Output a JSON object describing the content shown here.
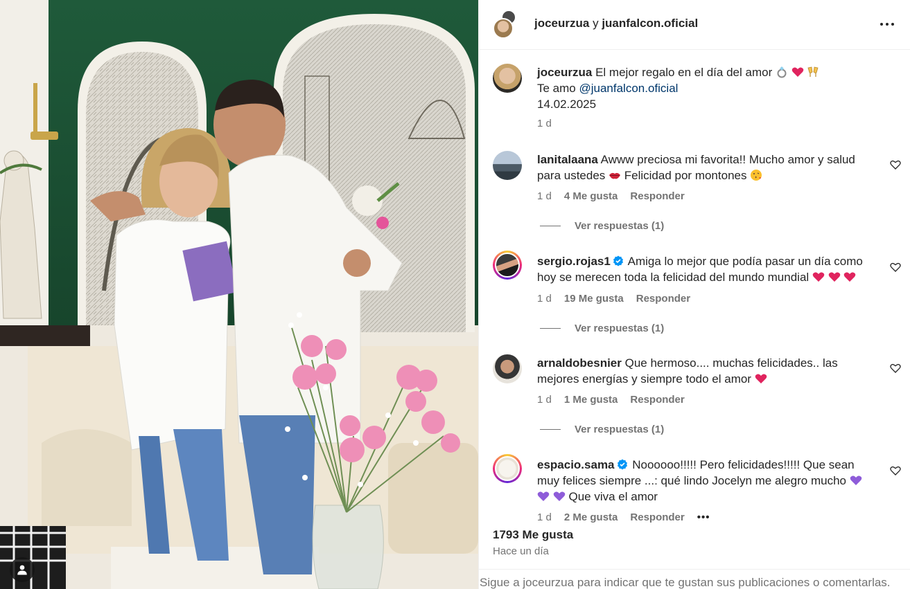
{
  "post": {
    "header_user1": "joceurzua",
    "header_conn": " y ",
    "header_user2": "juanfalcon.oficial",
    "caption_user": "joceurzua",
    "caption_line1": "El mejor regalo en el día del amor",
    "caption_line2_prefix": "Te amo ",
    "caption_mention": "@juanfalcon.oficial",
    "caption_line3": "14.02.2025",
    "caption_time": "1 d",
    "likes": "1793 Me gusta",
    "time_ago": "Hace un día",
    "footer_text": "Sigue a joceurzua para indicar que te gustan sus publicaciones o comentarlas."
  },
  "comments": [
    {
      "user": "lanitalaana",
      "text": "Awww preciosa mi favorita!! Mucho amor y salud para ustedes",
      "text2": "Felicidad por montones",
      "time": "1 d",
      "likes": "4 Me gusta",
      "reply": "Responder",
      "view_replies": "Ver respuestas (1)"
    },
    {
      "user": "sergio.rojas1",
      "text": "Amiga lo mejor que podía pasar un día como hoy se merecen toda la felicidad del mundo mundial",
      "time": "1 d",
      "likes": "19 Me gusta",
      "reply": "Responder",
      "view_replies": "Ver respuestas (1)"
    },
    {
      "user": "arnaldobesnier",
      "text": "Que hermoso.... muchas felicidades.. las mejores energías y siempre todo el amor",
      "time": "1 d",
      "likes": "1 Me gusta",
      "reply": "Responder",
      "view_replies": "Ver respuestas (1)"
    },
    {
      "user": "espacio.sama",
      "text": "Noooooo!!!!! Pero felicidades!!!!! Que sean muy felices siempre ...: qué lindo Jocelyn me alegro mucho",
      "text2": "Que viva el amor",
      "time": "1 d",
      "likes": "2 Me gusta",
      "reply": "Responder",
      "more": "•••"
    }
  ],
  "icons": {
    "more": "more-horizontal-icon",
    "heart": "heart-outline-icon",
    "verified": "verified-badge-icon",
    "user": "user-icon"
  },
  "colors": {
    "text": "#262626",
    "secondary": "#737373",
    "link": "#00376b",
    "verified": "#0095f6",
    "border": "#efefef"
  }
}
